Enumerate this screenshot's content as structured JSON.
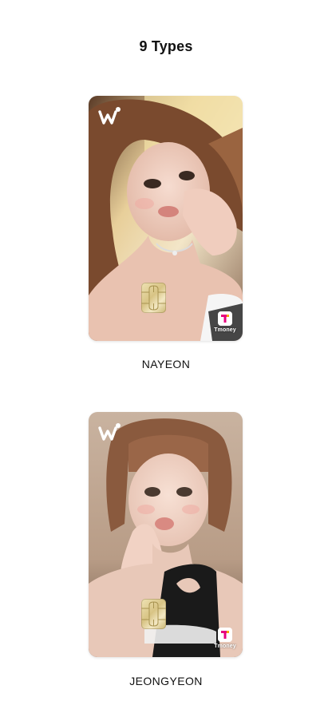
{
  "page": {
    "title": "9 Types"
  },
  "cards": [
    {
      "caption": "NAYEON",
      "brand_icon": "weverse-w-logo",
      "transit_icon": "tmoney-logo",
      "transit_label": "Tmoney"
    },
    {
      "caption": "JEONGYEON",
      "brand_icon": "weverse-w-logo",
      "transit_icon": "tmoney-logo",
      "transit_label": "Tmoney"
    }
  ],
  "colors": {
    "background": "#ffffff",
    "text": "#111111",
    "tmoney_accent": "#e6007e"
  }
}
